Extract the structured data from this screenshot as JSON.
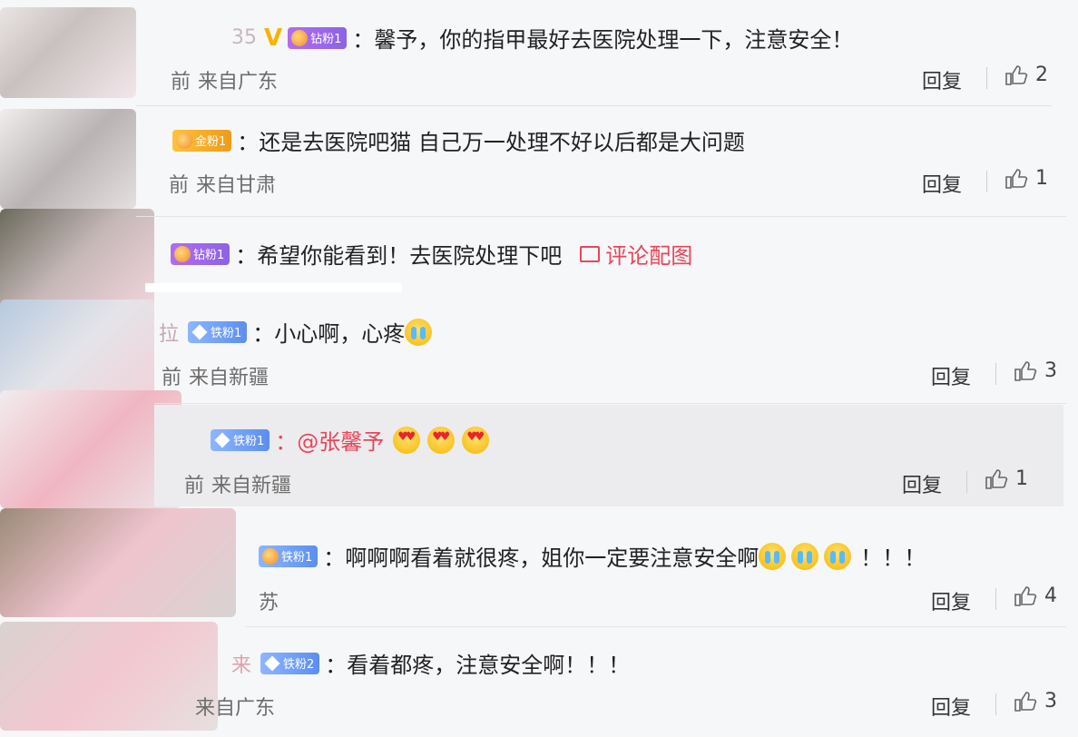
{
  "comments": [
    {
      "id": "c1",
      "name_frag": "35",
      "vip": "V",
      "badge": {
        "label": "钻粉1",
        "style": "purple",
        "icon": "crown-icon"
      },
      "text": "：馨予，你的指甲最好去医院处理一下，注意安全！",
      "time_frag": "前",
      "location": "来自广东",
      "reply": "回复",
      "likes": "2"
    },
    {
      "id": "c2",
      "badge": {
        "label": "金粉1",
        "style": "gold",
        "icon": "crown-icon"
      },
      "text": "：还是去医院吧猫 自己万一处理不好以后都是大问题",
      "time_frag": "前",
      "location": "来自甘肃",
      "reply": "回复",
      "likes": "1"
    },
    {
      "id": "c3",
      "badge": {
        "label": "钻粉1",
        "style": "purple",
        "icon": "crown-icon"
      },
      "text": "：希望你能看到！去医院处理下吧",
      "attachment": "评论配图"
    },
    {
      "id": "c4",
      "name_frag": "拉",
      "badge": {
        "label": "铁粉1",
        "style": "blue",
        "icon": "diamond-icon"
      },
      "text": "：小心啊，心疼",
      "emojis": [
        "crying-emoji"
      ],
      "time_frag": "前",
      "location": "来自新疆",
      "reply": "回复",
      "likes": "3"
    },
    {
      "id": "c5",
      "badge": {
        "label": "铁粉1",
        "style": "blue",
        "icon": "diamond-icon"
      },
      "mention": "：@张馨予",
      "emojis": [
        "heart-eyes-emoji",
        "heart-eyes-emoji",
        "heart-eyes-emoji"
      ],
      "time_frag": "前",
      "location": "来自新疆",
      "reply": "回复",
      "likes": "1"
    },
    {
      "id": "c6",
      "badge": {
        "label": "铁粉1",
        "style": "blue",
        "icon": "crown-icon"
      },
      "text": "：啊啊啊看着就很疼，姐你一定要注意安全啊",
      "emojis": [
        "crying-emoji",
        "crying-emoji",
        "crying-emoji"
      ],
      "suffix": "！！！",
      "location_frag": "苏",
      "reply": "回复",
      "likes": "4"
    },
    {
      "id": "c7",
      "name_frag": "来",
      "badge": {
        "label": "铁粉2",
        "style": "blue",
        "icon": "diamond-icon"
      },
      "text": "：看着都疼，注意安全啊！！！",
      "location": "来自广东",
      "reply": "回复",
      "likes": "3"
    }
  ],
  "colors": {
    "accent": "#e8465a",
    "vip": "#f5b400",
    "background": "#f6f7f9"
  }
}
